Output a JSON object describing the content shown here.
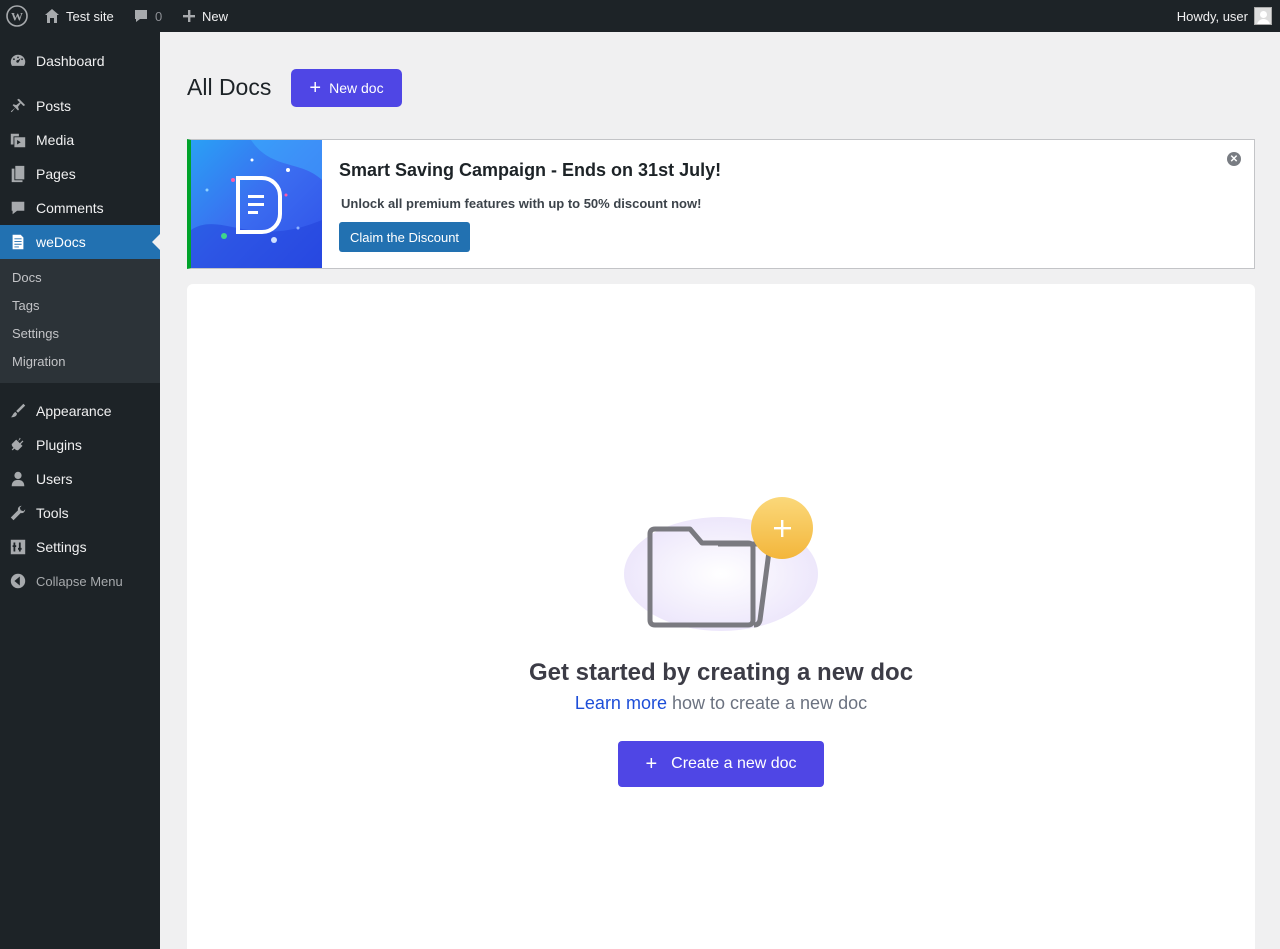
{
  "adminbar": {
    "site_name": "Test site",
    "comments_count": "0",
    "new_label": "New",
    "greeting": "Howdy, user"
  },
  "sidebar": {
    "items": [
      {
        "label": "Dashboard",
        "icon": "dashboard-icon"
      },
      {
        "label": "Posts",
        "icon": "pushpin-icon"
      },
      {
        "label": "Media",
        "icon": "media-icon"
      },
      {
        "label": "Pages",
        "icon": "pages-icon"
      },
      {
        "label": "Comments",
        "icon": "comment-icon"
      },
      {
        "label": "weDocs",
        "icon": "document-icon",
        "active": true
      },
      {
        "label": "Appearance",
        "icon": "brush-icon"
      },
      {
        "label": "Plugins",
        "icon": "plug-icon"
      },
      {
        "label": "Users",
        "icon": "user-icon"
      },
      {
        "label": "Tools",
        "icon": "wrench-icon"
      },
      {
        "label": "Settings",
        "icon": "settings-icon"
      },
      {
        "label": "Collapse Menu",
        "icon": "collapse-icon"
      }
    ],
    "submenu": [
      "Docs",
      "Tags",
      "Settings",
      "Migration"
    ]
  },
  "header": {
    "title": "All Docs",
    "new_doc_label": "New doc"
  },
  "notice": {
    "title": "Smart Saving Campaign - Ends on 31st July!",
    "text": "Unlock all premium features with up to 50% discount now!",
    "button_label": "Claim the Discount",
    "accent_color": "#00a32a"
  },
  "empty_state": {
    "heading": "Get started by creating a new doc",
    "learn_more_link": "Learn more",
    "sub_text": " how to create a new doc",
    "create_button_label": "Create a new doc"
  },
  "colors": {
    "primary": "#4f46e5",
    "wp_blue": "#2271b1",
    "adminbar_bg": "#1d2327"
  }
}
